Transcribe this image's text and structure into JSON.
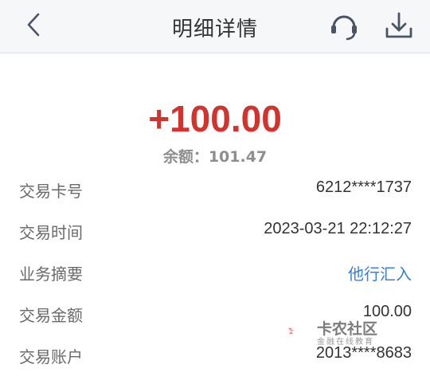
{
  "header": {
    "title": "明细详情",
    "back_icon": "back-chevron-icon",
    "support_icon": "headset-icon",
    "download_icon": "download-icon"
  },
  "summary": {
    "amount": "+100.00",
    "balance": "余额：101.47"
  },
  "details": [
    {
      "label": "交易卡号",
      "value": "6212****1737"
    },
    {
      "label": "交易时间",
      "value": "2023-03-21 22:12:27"
    },
    {
      "label": "业务摘要",
      "value": "他行汇入"
    },
    {
      "label": "交易金额",
      "value": "100.00"
    },
    {
      "label": "交易账户",
      "value": "2013****8683"
    }
  ],
  "watermark": {
    "text": "卡农社区",
    "subtext": "金融在线教育"
  },
  "colors": {
    "amount": "#d2332c",
    "link": "#3c7fd6",
    "header_bg": "#f6f7f9",
    "icon": "#4a5563"
  }
}
